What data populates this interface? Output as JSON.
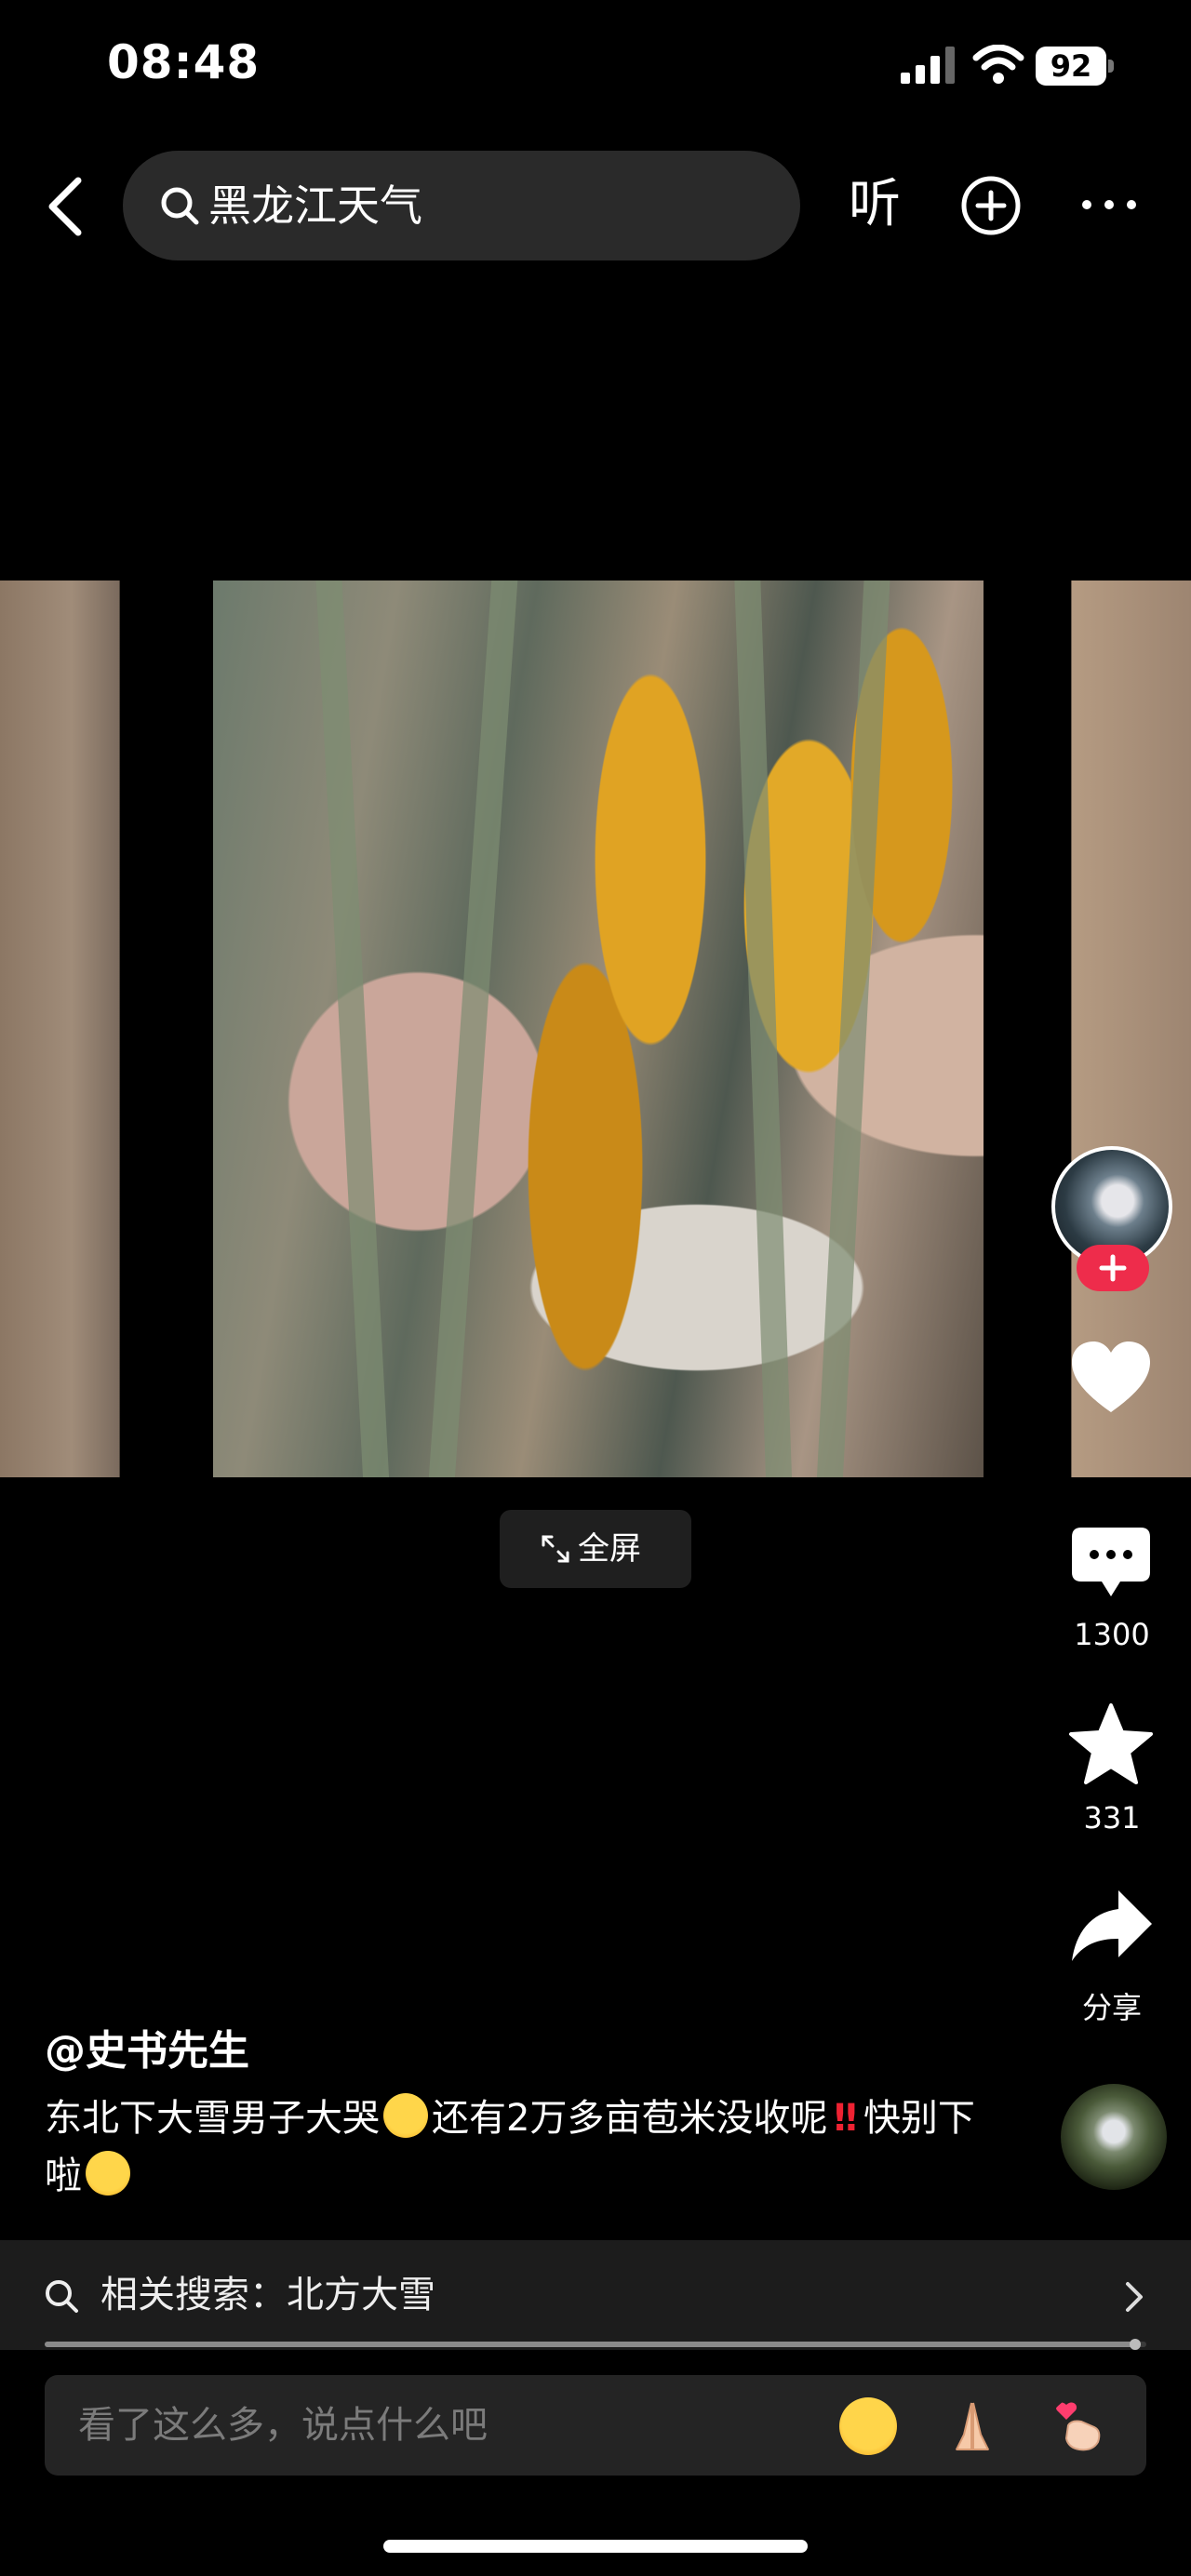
{
  "status_bar": {
    "time": "08:48",
    "battery": "92"
  },
  "top_bar": {
    "search_query": "黑龙江天气",
    "listen_label": "听"
  },
  "video": {
    "fullscreen_label": "全屏"
  },
  "actions": {
    "comment_count": "1300",
    "favorite_count": "331",
    "share_label": "分享"
  },
  "post": {
    "author": "@史书先生",
    "caption_part1": "东北下大雪男子大哭",
    "caption_part2": "还有2万多亩苞米没收呢",
    "caption_part3": "快别下啦",
    "emoji_1": "crying-face",
    "emoji_2": "double-exclamation",
    "emoji_3": "tired-face"
  },
  "related_search": {
    "label": "相关搜索：北方大雪"
  },
  "progress": {
    "fraction": 0.99
  },
  "comment_box": {
    "placeholder": "看了这么多，说点什么吧",
    "quick_emojis": [
      "laughing-face",
      "praying-hands",
      "finger-heart"
    ]
  },
  "colors": {
    "background": "#000000",
    "accent_red": "#ee2c4b",
    "input_bg": "#242424"
  }
}
